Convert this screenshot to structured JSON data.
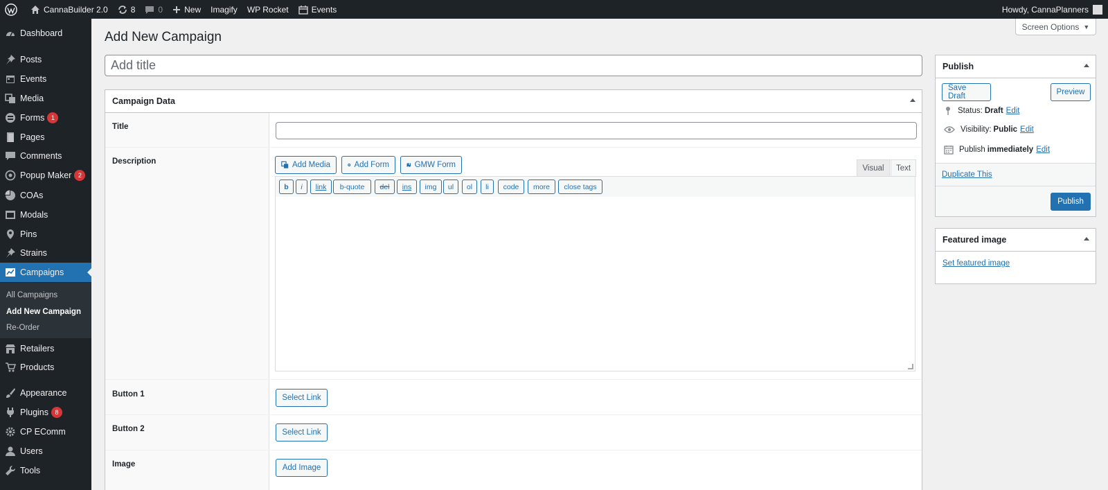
{
  "adminbar": {
    "site_name": "CannaBuilder 2.0",
    "updates_count": "8",
    "comments_count": "0",
    "new_label": "New",
    "imagify_label": "Imagify",
    "wprocket_label": "WP Rocket",
    "events_label": "Events",
    "howdy": "Howdy, CannaPlanners"
  },
  "sidebar": {
    "items": [
      {
        "label": "Dashboard",
        "icon": "dashboard-icon"
      },
      {
        "label": "Posts",
        "icon": "pin-icon"
      },
      {
        "label": "Events",
        "icon": "calendar-icon"
      },
      {
        "label": "Media",
        "icon": "media-icon"
      },
      {
        "label": "Forms",
        "icon": "forms-icon",
        "badge": "1"
      },
      {
        "label": "Pages",
        "icon": "pages-icon"
      },
      {
        "label": "Comments",
        "icon": "comment-icon"
      },
      {
        "label": "Popup Maker",
        "icon": "popup-icon",
        "badge": "2"
      },
      {
        "label": "COAs",
        "icon": "pie-icon"
      },
      {
        "label": "Modals",
        "icon": "modals-icon"
      },
      {
        "label": "Pins",
        "icon": "location-icon"
      },
      {
        "label": "Strains",
        "icon": "pin-icon"
      },
      {
        "label": "Campaigns",
        "icon": "chart-icon"
      },
      {
        "label": "Retailers",
        "icon": "store-icon"
      },
      {
        "label": "Products",
        "icon": "cart-icon"
      },
      {
        "label": "Appearance",
        "icon": "brush-icon"
      },
      {
        "label": "Plugins",
        "icon": "plugin-icon",
        "badge": "8"
      },
      {
        "label": "CP EComm",
        "icon": "gear-icon"
      },
      {
        "label": "Users",
        "icon": "user-icon"
      },
      {
        "label": "Tools",
        "icon": "wrench-icon"
      }
    ],
    "submenu": [
      "All Campaigns",
      "Add New Campaign",
      "Re-Order"
    ]
  },
  "screen_options": "Screen Options",
  "page_title": "Add New Campaign",
  "title_placeholder": "Add title",
  "campaign_data": {
    "header": "Campaign Data",
    "title_label": "Title",
    "description_label": "Description",
    "add_media": "Add Media",
    "add_form": "Add Form",
    "gmw_form": "GMW Form",
    "tab_visual": "Visual",
    "tab_text": "Text",
    "quicktags": [
      "b",
      "i",
      "link",
      "b-quote",
      "del",
      "ins",
      "img",
      "ul",
      "ol",
      "li",
      "code",
      "more",
      "close tags"
    ],
    "button1_label": "Button 1",
    "button2_label": "Button 2",
    "select_link": "Select Link",
    "image_label": "Image",
    "add_image": "Add Image"
  },
  "publish": {
    "header": "Publish",
    "save_draft": "Save Draft",
    "preview": "Preview",
    "status_label": "Status:",
    "status_value": "Draft",
    "visibility_label": "Visibility:",
    "visibility_value": "Public",
    "publish_label": "Publish",
    "publish_value": "immediately",
    "edit": "Edit",
    "duplicate": "Duplicate This",
    "publish_button": "Publish"
  },
  "featured": {
    "header": "Featured image",
    "set_link": "Set featured image"
  },
  "colors": {
    "admin_dark": "#1d2327",
    "accent": "#2271b1",
    "badge_red": "#d63638"
  }
}
